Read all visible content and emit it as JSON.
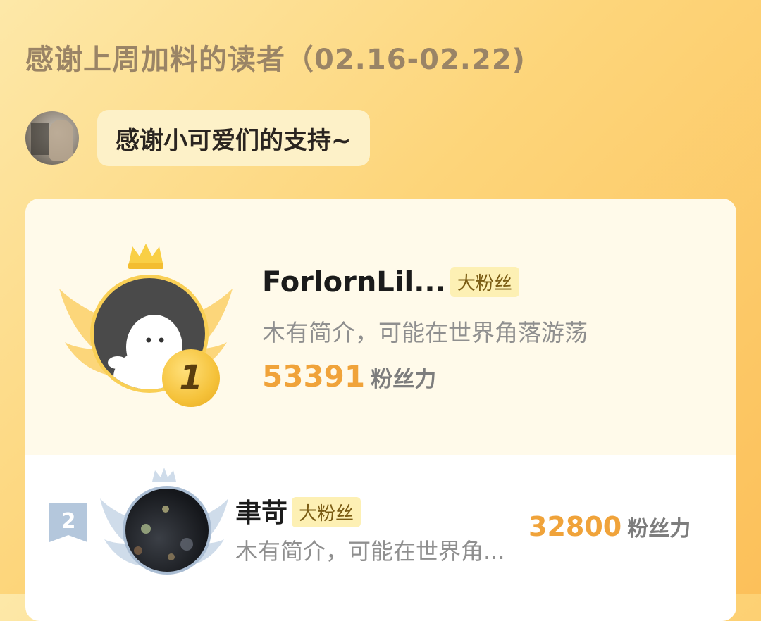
{
  "header": {
    "title": "感谢上周加料的读者（02.16-02.22)"
  },
  "author_message": {
    "text": "感谢小可爱们的支持~"
  },
  "ranking": [
    {
      "rank": "1",
      "name": "ForlornLil...",
      "badge": "大粉丝",
      "bio": "木有简介，可能在世界角落游荡",
      "score": "53391",
      "score_unit": "粉丝力"
    },
    {
      "rank": "2",
      "name": "聿苛",
      "badge": "大粉丝",
      "bio": "木有简介，可能在世界角...",
      "score": "32800",
      "score_unit": "粉丝力"
    }
  ],
  "colors": {
    "background_top": "#fde8a8",
    "background_bottom": "#fcc05a",
    "gold_accent": "#f0a33a",
    "badge_bg": "#fdf0b4",
    "silver_accent": "#aabdd3"
  },
  "icons": [
    "crown-icon",
    "wings-icon",
    "gold-medal-icon",
    "rank-flag-icon"
  ]
}
